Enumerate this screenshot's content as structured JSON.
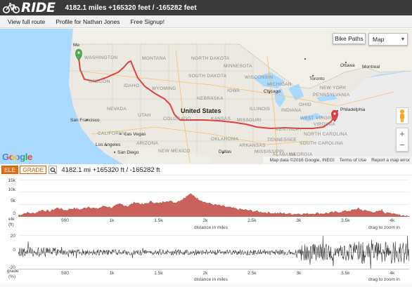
{
  "header": {
    "logo_text": "RIDE",
    "route_stats": "4182.1 miles +165320 feet / -165282 feet"
  },
  "nav": {
    "items": [
      "View full route",
      "Profile for Nathan Jones",
      "Free Signup!"
    ]
  },
  "map": {
    "bike_paths_label": "Bike Paths",
    "map_type_label": "Map",
    "google_logo": "Google",
    "footer": {
      "data": "Map data ©2016 Google, INEGI",
      "terms": "Terms of Use",
      "report": "Report a map error"
    },
    "labels": {
      "washington": "WASHINGTON",
      "montana": "MONTANA",
      "north_dakota": "NORTH DAKOTA",
      "minnesota": "MINNESOTA",
      "oregon": "OREGON",
      "idaho": "IDAHO",
      "south_dakota": "SOUTH DAKOTA",
      "wisconsin": "WISCONSIN",
      "wyoming": "WYOMING",
      "michigan": "MICHIGAN",
      "iowa": "IOWA",
      "nebraska": "NEBRASKA",
      "nevada": "NEVADA",
      "utah": "UTAH",
      "illinois": "ILLINOIS",
      "ohio": "OHIO",
      "pennsylvania": "PENNSYLVANIA",
      "united_states": "United States",
      "colorado": "COLORADO",
      "kansas": "KANSAS",
      "missouri": "MISSOURI",
      "indiana": "INDIANA",
      "west_virginia": "WEST VIRGINIA",
      "virginia": "VIRGINIA",
      "kentucky": "KENTUCKY",
      "california": "CALIFORNIA",
      "arizona": "ARIZONA",
      "oklahoma": "OKLAHOMA",
      "tennessee": "TENNESSEE",
      "north_carolina": "NORTH CAROLINA",
      "arkansas": "ARKANSAS",
      "south_carolina": "SOUTH CAROLINA",
      "new_mexico": "NEW MEXICO",
      "mississippi": "MISSISSIPPI",
      "alabama": "ALABAMA",
      "georgia": "GEORGIA",
      "new_york": "NEW YORK",
      "ottawa": "Ottawa",
      "montreal": "Montreal",
      "toronto": "Toronto",
      "chicago": "Chicago",
      "philadelphia": "Philadelphia",
      "san_francisco": "San Francisco",
      "las_vegas": "Las Vegas",
      "los_angeles": "Los Angeles",
      "san_diego": "San Diego",
      "dallas": "Dallas",
      "mexico_left": "Me"
    }
  },
  "elevation": {
    "tab_ele": "ELE",
    "tab_grade": "GRADE",
    "summary": "4182.1 mi +165320 ft / -165282 ft",
    "y_ticks": [
      "15k",
      "10k",
      "5k",
      "0"
    ],
    "y_label_top": "ele",
    "y_label_bottom": "(ft)",
    "x_ticks": [
      "500",
      "1k",
      "1.5k",
      "2k",
      "2.5k",
      "3k",
      "3.5k",
      "4k"
    ],
    "x_title": "distance in miles",
    "zoom_hint": "drag to zoom in",
    "fill_color": "#c9625a",
    "profile_max_ft": 15000
  },
  "grade": {
    "y_ticks": [
      "20",
      "0",
      "-20"
    ],
    "y_label_top": "grade",
    "y_label_bottom": "(%)",
    "x_ticks": [
      "500",
      "1k",
      "1.5k",
      "2k",
      "2.5k",
      "3k",
      "3.5k",
      "4k"
    ],
    "x_title": "distance in miles",
    "zoom_hint": "drag to zoom in"
  },
  "colors": {
    "header_bg": "#3a3a3a",
    "route": "#e04040",
    "tab_active": "#e36c1a"
  }
}
